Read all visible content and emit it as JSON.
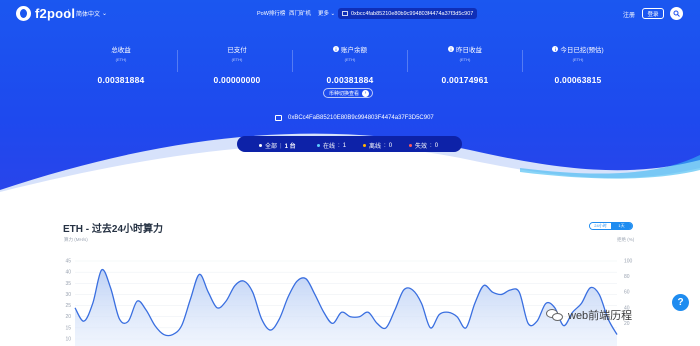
{
  "nav": {
    "logo": "f2pool",
    "language": "简体中文",
    "links": [
      "PoW排行榜",
      "西门矿机",
      "更多"
    ],
    "address_short": "0xbcc4fab85210e80b9c994803f4474a37f3d5c907",
    "login": "注册",
    "register": "登录"
  },
  "stats": [
    {
      "label": "总收益",
      "unit": "(ETH)",
      "value": "0.00381884"
    },
    {
      "label": "已支付",
      "unit": "(ETH)",
      "value": "0.00000000"
    },
    {
      "label": "账户余额",
      "unit": "(ETH)",
      "value": "0.00381884"
    },
    {
      "label": "昨日收益",
      "unit": "(ETH)",
      "value": "0.00174961"
    },
    {
      "label": "今日已挖(预估)",
      "unit": "(ETH)",
      "value": "0.00063815"
    }
  ],
  "coin_switch": "币种切换查看",
  "wallet_address": "0xBCc4FaB85210E80B9c994803F4474a37F3D5C907",
  "workers": {
    "all_label": "全部",
    "all_count": "1 台",
    "online_label": "在线",
    "online_count": "1",
    "offline_label": "离线",
    "offline_count": "0",
    "dead_label": "失效",
    "dead_count": "0"
  },
  "chart": {
    "coin": "ETH",
    "title": "过去24小时算力",
    "toggle_left": "24小时",
    "toggle_right": "1天",
    "left_axis_title": "算力 (MH/s)",
    "right_axis_title": "拒绝 (%)"
  },
  "chart_data": {
    "type": "area",
    "title": "ETH - 过去24小时算力",
    "ylabel": "算力 (MH/s)",
    "y2label": "拒绝 (%)",
    "ylim": [
      10,
      45
    ],
    "y2lim": [
      0,
      100
    ],
    "left_ticks": [
      45,
      40,
      35,
      30,
      25,
      20,
      15,
      10
    ],
    "right_ticks": [
      100,
      80,
      60,
      40,
      20
    ],
    "series": [
      {
        "values": [
          24,
          18,
          26,
          41,
          33,
          19,
          18,
          27,
          23,
          16,
          12,
          12,
          16,
          28,
          39,
          31,
          24,
          27,
          34,
          36,
          31,
          19,
          14,
          19,
          29,
          36,
          37,
          30,
          22,
          17,
          22,
          20,
          20,
          22,
          17,
          15,
          23,
          32,
          32,
          26,
          15,
          21,
          22,
          20,
          15,
          26,
          34,
          31,
          30,
          32,
          31,
          17,
          18,
          26,
          24,
          16,
          22,
          26,
          33,
          30,
          19,
          12
        ]
      }
    ]
  },
  "watermark": "web前端历程",
  "colors": {
    "brand": "#1b57f0",
    "line": "#3a6fe0",
    "fill": "#c7d7f6",
    "dark": "#0d22a8"
  }
}
